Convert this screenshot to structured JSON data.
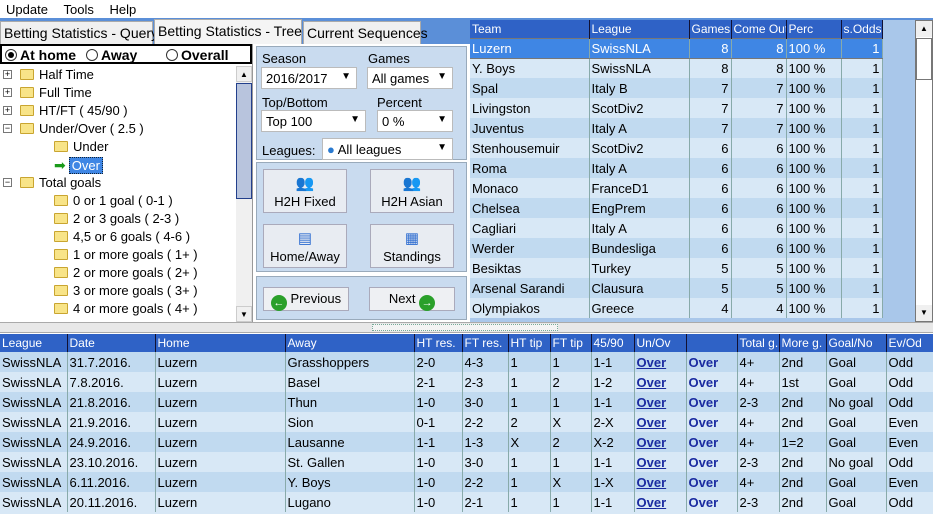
{
  "menu": [
    "Update",
    "Tools",
    "Help"
  ],
  "tabs": [
    "Betting Statistics - Query",
    "Betting Statistics - Tree",
    "Current Sequences"
  ],
  "active_tab": 1,
  "venue": {
    "options": [
      "At home",
      "Away",
      "Overall"
    ],
    "selected": "At home"
  },
  "tree": [
    {
      "label": "Half Time",
      "level": 0,
      "expander": "+"
    },
    {
      "label": "Full Time",
      "level": 0,
      "expander": "+"
    },
    {
      "label": "HT/FT  ( 45/90 )",
      "level": 0,
      "expander": "+"
    },
    {
      "label": "Under/Over ( 2.5 )",
      "level": 0,
      "expander": "-"
    },
    {
      "label": "Under",
      "level": 1
    },
    {
      "label": "Over",
      "level": 1,
      "selected": true
    },
    {
      "label": "Total goals",
      "level": 0,
      "expander": "-"
    },
    {
      "label": "0 or 1 goal ( 0-1 )",
      "level": 1
    },
    {
      "label": "2 or 3 goals ( 2-3 )",
      "level": 1
    },
    {
      "label": "4,5 or 6 goals ( 4-6 )",
      "level": 1
    },
    {
      "label": "1 or more goals ( 1+ )",
      "level": 1
    },
    {
      "label": "2 or more goals ( 2+ )",
      "level": 1
    },
    {
      "label": "3 or more goals ( 3+ )",
      "level": 1
    },
    {
      "label": "4 or more goals ( 4+ )",
      "level": 1
    }
  ],
  "filters": {
    "season_label": "Season",
    "season": "2016/2017",
    "games_label": "Games",
    "games": "All games",
    "topbottom_label": "Top/Bottom",
    "topbottom": "Top 100",
    "percent_label": "Percent",
    "percent": "0 %",
    "leagues_label": "Leagues:",
    "leagues": "All leagues"
  },
  "buttons": {
    "h2h_fixed": "H2H Fixed",
    "h2h_asian": "H2H Asian",
    "home_away": "Home/Away",
    "standings": "Standings",
    "previous": "Previous",
    "next": "Next"
  },
  "top_table": {
    "columns": [
      "Team",
      "League",
      "Games",
      "Come Out",
      "Perc",
      "s.Odds"
    ],
    "rows": [
      [
        "Luzern",
        "SwissNLA",
        "8",
        "8",
        "100 %",
        "1"
      ],
      [
        "Y. Boys",
        "SwissNLA",
        "8",
        "8",
        "100 %",
        "1"
      ],
      [
        "Spal",
        "Italy B",
        "7",
        "7",
        "100 %",
        "1"
      ],
      [
        "Livingston",
        "ScotDiv2",
        "7",
        "7",
        "100 %",
        "1"
      ],
      [
        "Juventus",
        "Italy A",
        "7",
        "7",
        "100 %",
        "1"
      ],
      [
        "Stenhousemuir",
        "ScotDiv2",
        "6",
        "6",
        "100 %",
        "1"
      ],
      [
        "Roma",
        "Italy A",
        "6",
        "6",
        "100 %",
        "1"
      ],
      [
        "Monaco",
        "FranceD1",
        "6",
        "6",
        "100 %",
        "1"
      ],
      [
        "Chelsea",
        "EngPrem",
        "6",
        "6",
        "100 %",
        "1"
      ],
      [
        "Cagliari",
        "Italy A",
        "6",
        "6",
        "100 %",
        "1"
      ],
      [
        "Werder",
        "Bundesliga",
        "6",
        "6",
        "100 %",
        "1"
      ],
      [
        "Besiktas",
        "Turkey",
        "5",
        "5",
        "100 %",
        "1"
      ],
      [
        "Arsenal Sarandi",
        "Clausura",
        "5",
        "5",
        "100 %",
        "1"
      ],
      [
        "Olympiakos",
        "Greece",
        "4",
        "4",
        "100 %",
        "1"
      ]
    ]
  },
  "bottom_table": {
    "columns": [
      "League",
      "Date",
      "Home",
      "Away",
      "HT res.",
      "FT res.",
      "HT tip",
      "FT tip",
      "45/90",
      "Un/Ov",
      "",
      "Total g.",
      "More g.",
      "Goal/No",
      "Ev/Od"
    ],
    "rows": [
      [
        "SwissNLA",
        "31.7.2016.",
        "Luzern",
        "Grasshoppers",
        "2-0",
        "4-3",
        "1",
        "1",
        "1-1",
        "Over",
        "Over",
        "4+",
        "2nd",
        "Goal",
        "Odd"
      ],
      [
        "SwissNLA",
        "7.8.2016.",
        "Luzern",
        "Basel",
        "2-1",
        "2-3",
        "1",
        "2",
        "1-2",
        "Over",
        "Over",
        "4+",
        "1st",
        "Goal",
        "Odd"
      ],
      [
        "SwissNLA",
        "21.8.2016.",
        "Luzern",
        "Thun",
        "1-0",
        "3-0",
        "1",
        "1",
        "1-1",
        "Over",
        "Over",
        "2-3",
        "2nd",
        "No goal",
        "Odd"
      ],
      [
        "SwissNLA",
        "21.9.2016.",
        "Luzern",
        "Sion",
        "0-1",
        "2-2",
        "2",
        "X",
        "2-X",
        "Over",
        "Over",
        "4+",
        "2nd",
        "Goal",
        "Even"
      ],
      [
        "SwissNLA",
        "24.9.2016.",
        "Luzern",
        "Lausanne",
        "1-1",
        "1-3",
        "X",
        "2",
        "X-2",
        "Over",
        "Over",
        "4+",
        "1=2",
        "Goal",
        "Even"
      ],
      [
        "SwissNLA",
        "23.10.2016.",
        "Luzern",
        "St. Gallen",
        "1-0",
        "3-0",
        "1",
        "1",
        "1-1",
        "Over",
        "Over",
        "2-3",
        "2nd",
        "No goal",
        "Odd"
      ],
      [
        "SwissNLA",
        "6.11.2016.",
        "Luzern",
        "Y. Boys",
        "1-0",
        "2-2",
        "1",
        "X",
        "1-X",
        "Over",
        "Over",
        "4+",
        "2nd",
        "Goal",
        "Even"
      ],
      [
        "SwissNLA",
        "20.11.2016.",
        "Luzern",
        "Lugano",
        "1-0",
        "2-1",
        "1",
        "1",
        "1-1",
        "Over",
        "Over",
        "2-3",
        "2nd",
        "Goal",
        "Odd"
      ]
    ]
  },
  "colors": {
    "header": "#2f62c6",
    "row_a": "#d8e8f6",
    "row_b": "#c1daf0",
    "selected": "#3f86e4",
    "panel": "#c9dbef"
  }
}
